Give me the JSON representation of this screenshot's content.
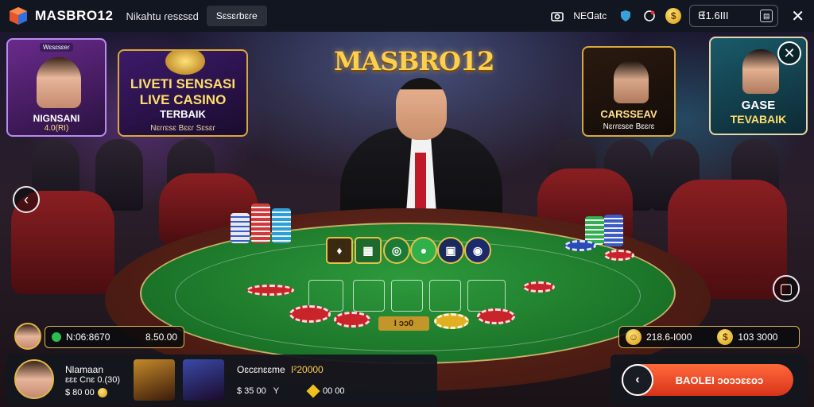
{
  "header": {
    "brand": "MASBRO12",
    "nav_link": "Nikahtu ɾesɛsɛd",
    "nav_button": "Sɛsɛɾbɛɾe",
    "network_label": "NEᗡatc",
    "balance": "ᘀ1.6III"
  },
  "banners": {
    "left_tag": "Wɛsɛsɛeɾ",
    "left_title": "NIGNSANI",
    "left_sub": "4.0(RI)",
    "live_line1": "LIVETI SENSASI",
    "live_line2": "LIVE CASINO",
    "live_line3": "TERBAIK",
    "live_line4": "Nɛɾɾɛsɛ Bɛɛɾ Sɛsɛɾ",
    "logo": "MASBRO12",
    "mid_right_title": "CARSSEAV",
    "mid_right_sub": "Nɛɾɾɛsɛe Bɛɛɾɛ",
    "right_title": "GASE",
    "right_sub": "TEVABAIK"
  },
  "table": {
    "bet_label": "I ɔɔ0"
  },
  "player": {
    "name": "N:06:8670",
    "amount": "8.50.00"
  },
  "right_stats": {
    "value1": "218.6-I000",
    "value2": "103 3000"
  },
  "bottom": {
    "p1_name": "Nlamaan",
    "p1_sub": "ɛɛɛ Cnɛ 0.(30)",
    "p1_amount": "$ 80 00",
    "p2_name": "Oɛcɛnɛɛme",
    "p2_bet": "I²20000",
    "p2_amount": "$ 35 00",
    "p2_suffix": "Y",
    "p3_amount": "00 00"
  },
  "cta": {
    "label": "BAOLEI ɔoɔɔɛɛoɔ"
  },
  "colors": {
    "accent_gold": "#e0b64c",
    "felt_green": "#2d9a3c",
    "cta_orange": "#ff6a3a"
  }
}
